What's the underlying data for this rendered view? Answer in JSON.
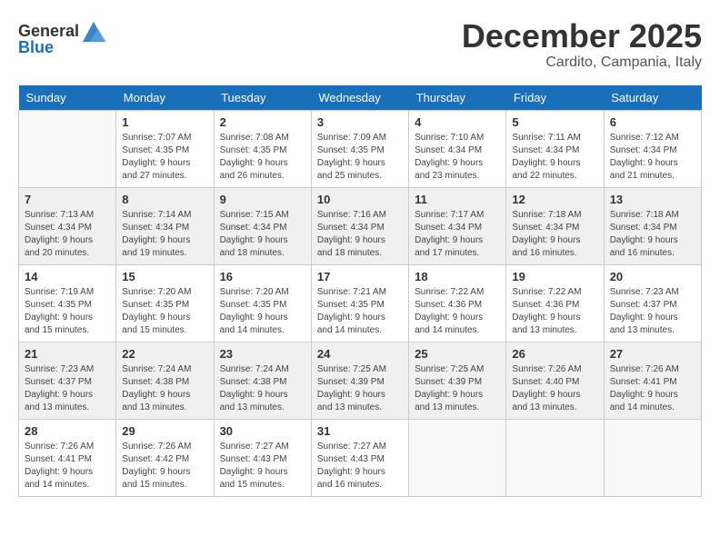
{
  "header": {
    "logo_general": "General",
    "logo_blue": "Blue",
    "month_title": "December 2025",
    "location": "Cardito, Campania, Italy"
  },
  "weekdays": [
    "Sunday",
    "Monday",
    "Tuesday",
    "Wednesday",
    "Thursday",
    "Friday",
    "Saturday"
  ],
  "weeks": [
    [
      {
        "day": "",
        "sunrise": "",
        "sunset": "",
        "daylight": ""
      },
      {
        "day": "1",
        "sunrise": "Sunrise: 7:07 AM",
        "sunset": "Sunset: 4:35 PM",
        "daylight": "Daylight: 9 hours and 27 minutes."
      },
      {
        "day": "2",
        "sunrise": "Sunrise: 7:08 AM",
        "sunset": "Sunset: 4:35 PM",
        "daylight": "Daylight: 9 hours and 26 minutes."
      },
      {
        "day": "3",
        "sunrise": "Sunrise: 7:09 AM",
        "sunset": "Sunset: 4:35 PM",
        "daylight": "Daylight: 9 hours and 25 minutes."
      },
      {
        "day": "4",
        "sunrise": "Sunrise: 7:10 AM",
        "sunset": "Sunset: 4:34 PM",
        "daylight": "Daylight: 9 hours and 23 minutes."
      },
      {
        "day": "5",
        "sunrise": "Sunrise: 7:11 AM",
        "sunset": "Sunset: 4:34 PM",
        "daylight": "Daylight: 9 hours and 22 minutes."
      },
      {
        "day": "6",
        "sunrise": "Sunrise: 7:12 AM",
        "sunset": "Sunset: 4:34 PM",
        "daylight": "Daylight: 9 hours and 21 minutes."
      }
    ],
    [
      {
        "day": "7",
        "sunrise": "Sunrise: 7:13 AM",
        "sunset": "Sunset: 4:34 PM",
        "daylight": "Daylight: 9 hours and 20 minutes."
      },
      {
        "day": "8",
        "sunrise": "Sunrise: 7:14 AM",
        "sunset": "Sunset: 4:34 PM",
        "daylight": "Daylight: 9 hours and 19 minutes."
      },
      {
        "day": "9",
        "sunrise": "Sunrise: 7:15 AM",
        "sunset": "Sunset: 4:34 PM",
        "daylight": "Daylight: 9 hours and 18 minutes."
      },
      {
        "day": "10",
        "sunrise": "Sunrise: 7:16 AM",
        "sunset": "Sunset: 4:34 PM",
        "daylight": "Daylight: 9 hours and 18 minutes."
      },
      {
        "day": "11",
        "sunrise": "Sunrise: 7:17 AM",
        "sunset": "Sunset: 4:34 PM",
        "daylight": "Daylight: 9 hours and 17 minutes."
      },
      {
        "day": "12",
        "sunrise": "Sunrise: 7:18 AM",
        "sunset": "Sunset: 4:34 PM",
        "daylight": "Daylight: 9 hours and 16 minutes."
      },
      {
        "day": "13",
        "sunrise": "Sunrise: 7:18 AM",
        "sunset": "Sunset: 4:34 PM",
        "daylight": "Daylight: 9 hours and 16 minutes."
      }
    ],
    [
      {
        "day": "14",
        "sunrise": "Sunrise: 7:19 AM",
        "sunset": "Sunset: 4:35 PM",
        "daylight": "Daylight: 9 hours and 15 minutes."
      },
      {
        "day": "15",
        "sunrise": "Sunrise: 7:20 AM",
        "sunset": "Sunset: 4:35 PM",
        "daylight": "Daylight: 9 hours and 15 minutes."
      },
      {
        "day": "16",
        "sunrise": "Sunrise: 7:20 AM",
        "sunset": "Sunset: 4:35 PM",
        "daylight": "Daylight: 9 hours and 14 minutes."
      },
      {
        "day": "17",
        "sunrise": "Sunrise: 7:21 AM",
        "sunset": "Sunset: 4:35 PM",
        "daylight": "Daylight: 9 hours and 14 minutes."
      },
      {
        "day": "18",
        "sunrise": "Sunrise: 7:22 AM",
        "sunset": "Sunset: 4:36 PM",
        "daylight": "Daylight: 9 hours and 14 minutes."
      },
      {
        "day": "19",
        "sunrise": "Sunrise: 7:22 AM",
        "sunset": "Sunset: 4:36 PM",
        "daylight": "Daylight: 9 hours and 13 minutes."
      },
      {
        "day": "20",
        "sunrise": "Sunrise: 7:23 AM",
        "sunset": "Sunset: 4:37 PM",
        "daylight": "Daylight: 9 hours and 13 minutes."
      }
    ],
    [
      {
        "day": "21",
        "sunrise": "Sunrise: 7:23 AM",
        "sunset": "Sunset: 4:37 PM",
        "daylight": "Daylight: 9 hours and 13 minutes."
      },
      {
        "day": "22",
        "sunrise": "Sunrise: 7:24 AM",
        "sunset": "Sunset: 4:38 PM",
        "daylight": "Daylight: 9 hours and 13 minutes."
      },
      {
        "day": "23",
        "sunrise": "Sunrise: 7:24 AM",
        "sunset": "Sunset: 4:38 PM",
        "daylight": "Daylight: 9 hours and 13 minutes."
      },
      {
        "day": "24",
        "sunrise": "Sunrise: 7:25 AM",
        "sunset": "Sunset: 4:39 PM",
        "daylight": "Daylight: 9 hours and 13 minutes."
      },
      {
        "day": "25",
        "sunrise": "Sunrise: 7:25 AM",
        "sunset": "Sunset: 4:39 PM",
        "daylight": "Daylight: 9 hours and 13 minutes."
      },
      {
        "day": "26",
        "sunrise": "Sunrise: 7:26 AM",
        "sunset": "Sunset: 4:40 PM",
        "daylight": "Daylight: 9 hours and 13 minutes."
      },
      {
        "day": "27",
        "sunrise": "Sunrise: 7:26 AM",
        "sunset": "Sunset: 4:41 PM",
        "daylight": "Daylight: 9 hours and 14 minutes."
      }
    ],
    [
      {
        "day": "28",
        "sunrise": "Sunrise: 7:26 AM",
        "sunset": "Sunset: 4:41 PM",
        "daylight": "Daylight: 9 hours and 14 minutes."
      },
      {
        "day": "29",
        "sunrise": "Sunrise: 7:26 AM",
        "sunset": "Sunset: 4:42 PM",
        "daylight": "Daylight: 9 hours and 15 minutes."
      },
      {
        "day": "30",
        "sunrise": "Sunrise: 7:27 AM",
        "sunset": "Sunset: 4:43 PM",
        "daylight": "Daylight: 9 hours and 15 minutes."
      },
      {
        "day": "31",
        "sunrise": "Sunrise: 7:27 AM",
        "sunset": "Sunset: 4:43 PM",
        "daylight": "Daylight: 9 hours and 16 minutes."
      },
      {
        "day": "",
        "sunrise": "",
        "sunset": "",
        "daylight": ""
      },
      {
        "day": "",
        "sunrise": "",
        "sunset": "",
        "daylight": ""
      },
      {
        "day": "",
        "sunrise": "",
        "sunset": "",
        "daylight": ""
      }
    ]
  ]
}
